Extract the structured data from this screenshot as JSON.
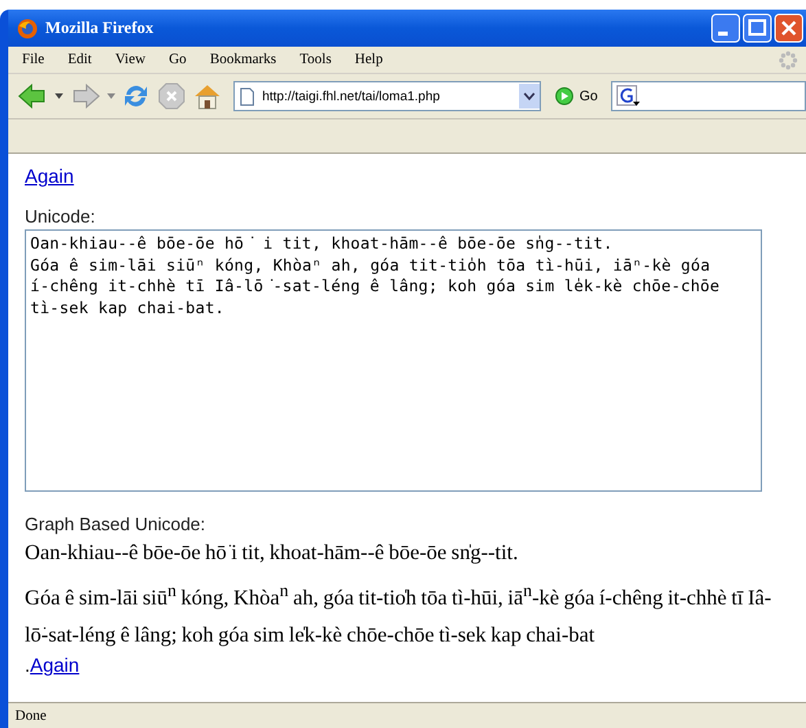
{
  "window": {
    "title": "Mozilla Firefox"
  },
  "menu": [
    "File",
    "Edit",
    "View",
    "Go",
    "Bookmarks",
    "Tools",
    "Help"
  ],
  "toolbar": {
    "url": "http://taigi.fhl.net/tai/loma1.php",
    "go": "Go"
  },
  "content": {
    "top_link": "Again",
    "unicode_label": "Unicode:",
    "unicode_text": "Oan-khiau--ê bōe-ōe hō͘ i tit, khoat-hām--ê bōe-ōe sn̍g--tit.\nGóa ê sim-lāi siūⁿ kóng, Khòaⁿ ah, góa tit-tio̍h tōa tì-hūi, iāⁿ-kè góa\ní-chêng it-chhè tī Iâ-lō͘-sat-léng ê lâng; koh góa sim le̍k-kè chōe-chōe\ntì-sek kap chai-bat.",
    "graph_label": "Graph Based Unicode:",
    "graph_lines": [
      "Oan-khiau--ê bōe-ōe hō͘ i tit, khoat-hām--ê bōe-ōe sn̍g--tit.",
      "Góa ê sim-lāi siū$^{n}$ kóng, Khòa$^{n}$ ah, góa tit-tio̍h tōa tì-hūi, iā$^{n}$-kè góa í-chêng it-chhè tī Iâ-lō͘-sat-léng ê lâng; koh góa sim le̍k-kè chōe-chōe tì-sek kap chai-bat"
    ],
    "trailing_mark": ".",
    "bottom_link": "Again"
  },
  "status_bar": "Done"
}
